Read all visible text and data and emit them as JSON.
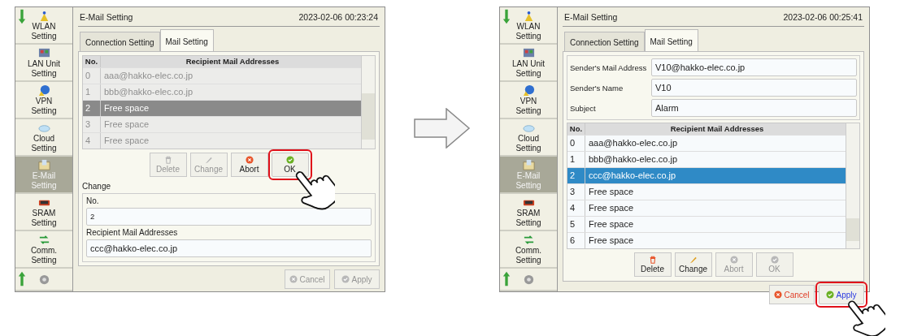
{
  "screens": [
    {
      "sidebar": [
        {
          "label": "WLAN Setting",
          "selected": false
        },
        {
          "label": "LAN Unit Setting",
          "selected": false
        },
        {
          "label": "VPN Setting",
          "selected": false
        },
        {
          "label": "Cloud Setting",
          "selected": false
        },
        {
          "label": "E-Mail Setting",
          "selected": true
        },
        {
          "label": "SRAM Setting",
          "selected": false
        },
        {
          "label": "Comm. Setting",
          "selected": false
        },
        {
          "selected": false
        }
      ],
      "title": "E-Mail Setting",
      "datetime": "2023-02-06  00:23:24",
      "tabs": [
        {
          "label": "Connection Setting",
          "selected": false
        },
        {
          "label": "Mail Setting",
          "selected": true
        }
      ],
      "table": {
        "columns": [
          "No.",
          "Recipient Mail Addresses"
        ],
        "rows": [
          {
            "no": "0",
            "address": "aaa@hakko-elec.co.jp",
            "selected": false,
            "disabled": true
          },
          {
            "no": "1",
            "address": "bbb@hakko-elec.co.jp",
            "selected": false,
            "disabled": true
          },
          {
            "no": "2",
            "address": "Free space",
            "selected": true,
            "disabled": false
          },
          {
            "no": "3",
            "address": "Free space",
            "selected": false,
            "disabled": true
          },
          {
            "no": "4",
            "address": "Free space",
            "selected": false,
            "disabled": true
          }
        ]
      },
      "action_buttons": [
        {
          "kind": "delete",
          "label": "Delete",
          "disabled": true,
          "highlighted": false
        },
        {
          "kind": "change",
          "label": "Change",
          "disabled": true,
          "highlighted": false
        },
        {
          "kind": "abort",
          "label": "Abort",
          "disabled": false,
          "highlighted": false
        },
        {
          "kind": "ok",
          "label": "OK",
          "disabled": false,
          "highlighted": true
        }
      ],
      "change_form": {
        "heading": "Change",
        "fields": [
          {
            "label": "No.",
            "value": "2"
          },
          {
            "label": "Recipient Mail Addresses",
            "value": "ccc@hakko-elec.co.jp"
          }
        ]
      },
      "footer_buttons": [
        {
          "kind": "cancel",
          "label": "Cancel",
          "disabled": true,
          "highlighted": false
        },
        {
          "kind": "apply",
          "label": "Apply",
          "disabled": true,
          "highlighted": false
        }
      ]
    },
    {
      "sidebar": [
        {
          "label": "WLAN Setting",
          "selected": false
        },
        {
          "label": "LAN Unit Setting",
          "selected": false
        },
        {
          "label": "VPN Setting",
          "selected": false
        },
        {
          "label": "Cloud Setting",
          "selected": false
        },
        {
          "label": "E-Mail Setting",
          "selected": true
        },
        {
          "label": "SRAM Setting",
          "selected": false
        },
        {
          "label": "Comm. Setting",
          "selected": false
        },
        {
          "selected": false
        }
      ],
      "title": "E-Mail Setting",
      "datetime": "2023-02-06  00:25:41",
      "tabs": [
        {
          "label": "Connection Setting",
          "selected": false
        },
        {
          "label": "Mail Setting",
          "selected": true
        }
      ],
      "sender_fields": [
        {
          "label": "Sender's Mail Address",
          "value": "V10@hakko-elec.co.jp"
        },
        {
          "label": "Sender's Name",
          "value": "V10"
        },
        {
          "label": "Subject",
          "value": "Alarm"
        }
      ],
      "table": {
        "columns": [
          "No.",
          "Recipient Mail Addresses"
        ],
        "rows": [
          {
            "no": "0",
            "address": "aaa@hakko-elec.co.jp",
            "selected": false,
            "disabled": false
          },
          {
            "no": "1",
            "address": "bbb@hakko-elec.co.jp",
            "selected": false,
            "disabled": false
          },
          {
            "no": "2",
            "address": "ccc@hakko-elec.co.jp",
            "selected": true,
            "disabled": false
          },
          {
            "no": "3",
            "address": "Free space",
            "selected": false,
            "disabled": false
          },
          {
            "no": "4",
            "address": "Free space",
            "selected": false,
            "disabled": false
          },
          {
            "no": "5",
            "address": "Free space",
            "selected": false,
            "disabled": false
          },
          {
            "no": "6",
            "address": "Free space",
            "selected": false,
            "disabled": false
          }
        ]
      },
      "action_buttons": [
        {
          "kind": "delete",
          "label": "Delete",
          "disabled": false,
          "highlighted": false
        },
        {
          "kind": "change",
          "label": "Change",
          "disabled": false,
          "highlighted": false
        },
        {
          "kind": "abort",
          "label": "Abort",
          "disabled": true,
          "highlighted": false
        },
        {
          "kind": "ok",
          "label": "OK",
          "disabled": true,
          "highlighted": false
        }
      ],
      "footer_buttons": [
        {
          "kind": "cancel",
          "label": "Cancel",
          "disabled": false,
          "highlighted": false
        },
        {
          "kind": "apply",
          "label": "Apply",
          "disabled": false,
          "highlighted": true
        }
      ]
    }
  ]
}
